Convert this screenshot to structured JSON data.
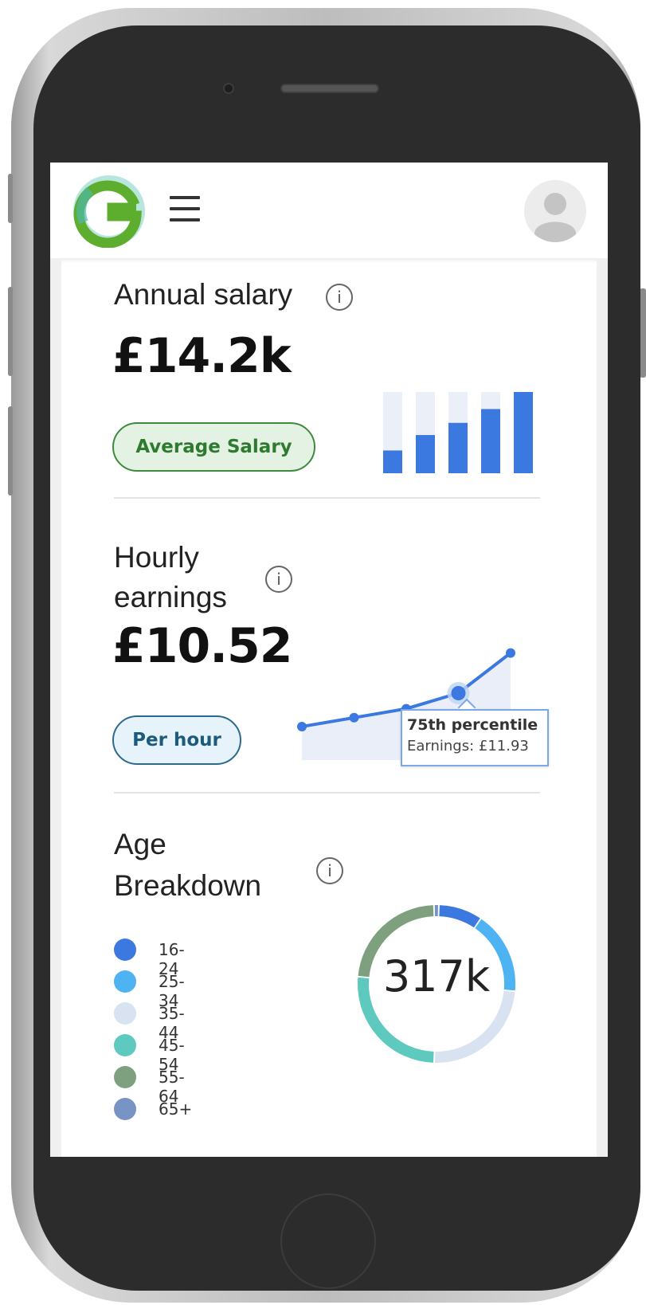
{
  "header": {
    "logo_letter": "G",
    "menu_icon": "hamburger-icon",
    "avatar_icon": "user-avatar-icon"
  },
  "annual_salary": {
    "title": "Annual salary",
    "value": "£14.2k",
    "badge": "Average Salary",
    "info_icon": "info-icon",
    "bars": [
      0.28,
      0.47,
      0.62,
      0.79,
      1.0
    ]
  },
  "hourly_earnings": {
    "title_line1": "Hourly",
    "title_line2": "earnings",
    "value": "£10.52",
    "badge": "Per hour",
    "info_icon": "info-icon",
    "line_points": [
      0.3,
      0.38,
      0.46,
      0.6,
      0.96
    ],
    "highlight_index": 3,
    "tooltip": {
      "title": "75th percentile",
      "body": "Earnings: £11.93"
    }
  },
  "age_breakdown": {
    "title_line1": "Age",
    "title_line2": "Breakdown",
    "info_icon": "info-icon",
    "total": "317k",
    "groups": [
      {
        "label": "16-24",
        "color": "#3b78e0",
        "share": 0.09
      },
      {
        "label": "25-34",
        "color": "#4db3f2",
        "share": 0.17
      },
      {
        "label": "35-44",
        "color": "#d8e2f0",
        "share": 0.24
      },
      {
        "label": "45-54",
        "color": "#5ec9bf",
        "share": 0.26
      },
      {
        "label": "55-64",
        "color": "#7ea07e",
        "share": 0.23
      },
      {
        "label": "65+",
        "color": "#7794c4",
        "share": 0.01
      }
    ]
  },
  "colors": {
    "accent_blue": "#3b78e0",
    "bar_track": "#eaeff8",
    "badge_green": "#2e7a2e",
    "badge_blue": "#1d5b7a"
  }
}
